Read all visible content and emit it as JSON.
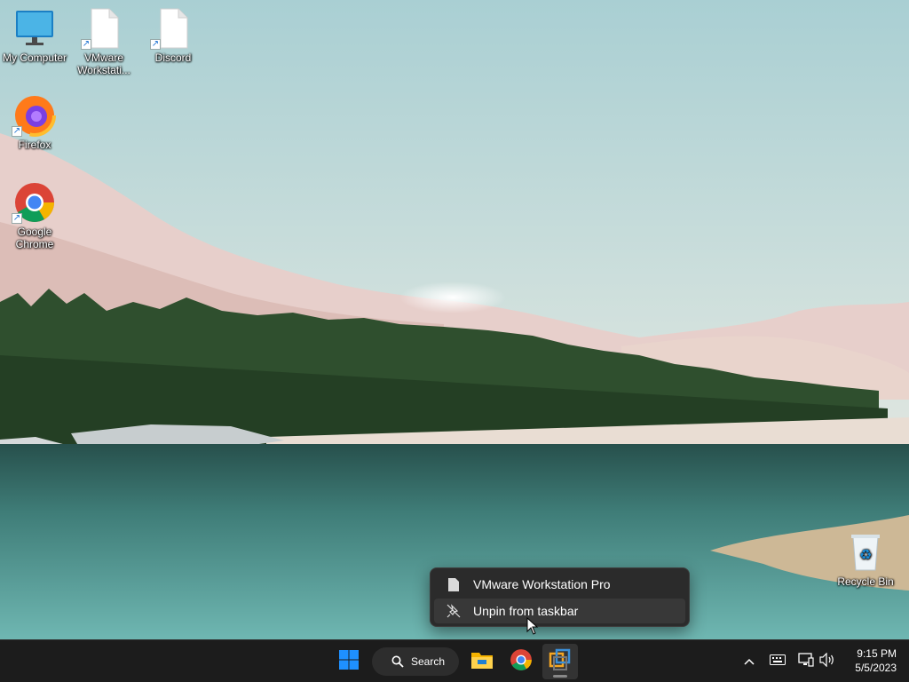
{
  "desktop": {
    "icons": [
      {
        "label": "My Computer",
        "icon": "monitor-icon"
      },
      {
        "label": "VMware Workstati...",
        "icon": "file-icon"
      },
      {
        "label": "Discord",
        "icon": "file-icon"
      },
      {
        "label": "Firefox",
        "icon": "firefox-icon"
      },
      {
        "label": "Google Chrome",
        "icon": "chrome-icon"
      },
      {
        "label": "Recycle Bin",
        "icon": "recycle-bin-icon"
      }
    ]
  },
  "context_menu": {
    "items": [
      {
        "label": "VMware Workstation Pro",
        "icon": "file-icon"
      },
      {
        "label": "Unpin from taskbar",
        "icon": "unpin-icon"
      }
    ]
  },
  "taskbar": {
    "search_label": "Search",
    "pinned": [
      "start-icon",
      "file-explorer-icon",
      "chrome-icon",
      "vmware-icon"
    ],
    "tray": [
      "chevron-up-icon",
      "keyboard-icon",
      "network-icon",
      "volume-icon"
    ],
    "time": "9:15 PM",
    "date": "5/5/2023"
  },
  "colors": {
    "taskbar_bg": "#1c1c1c",
    "menu_bg": "#2b2b2b",
    "start_blue": "#1e90ff"
  }
}
